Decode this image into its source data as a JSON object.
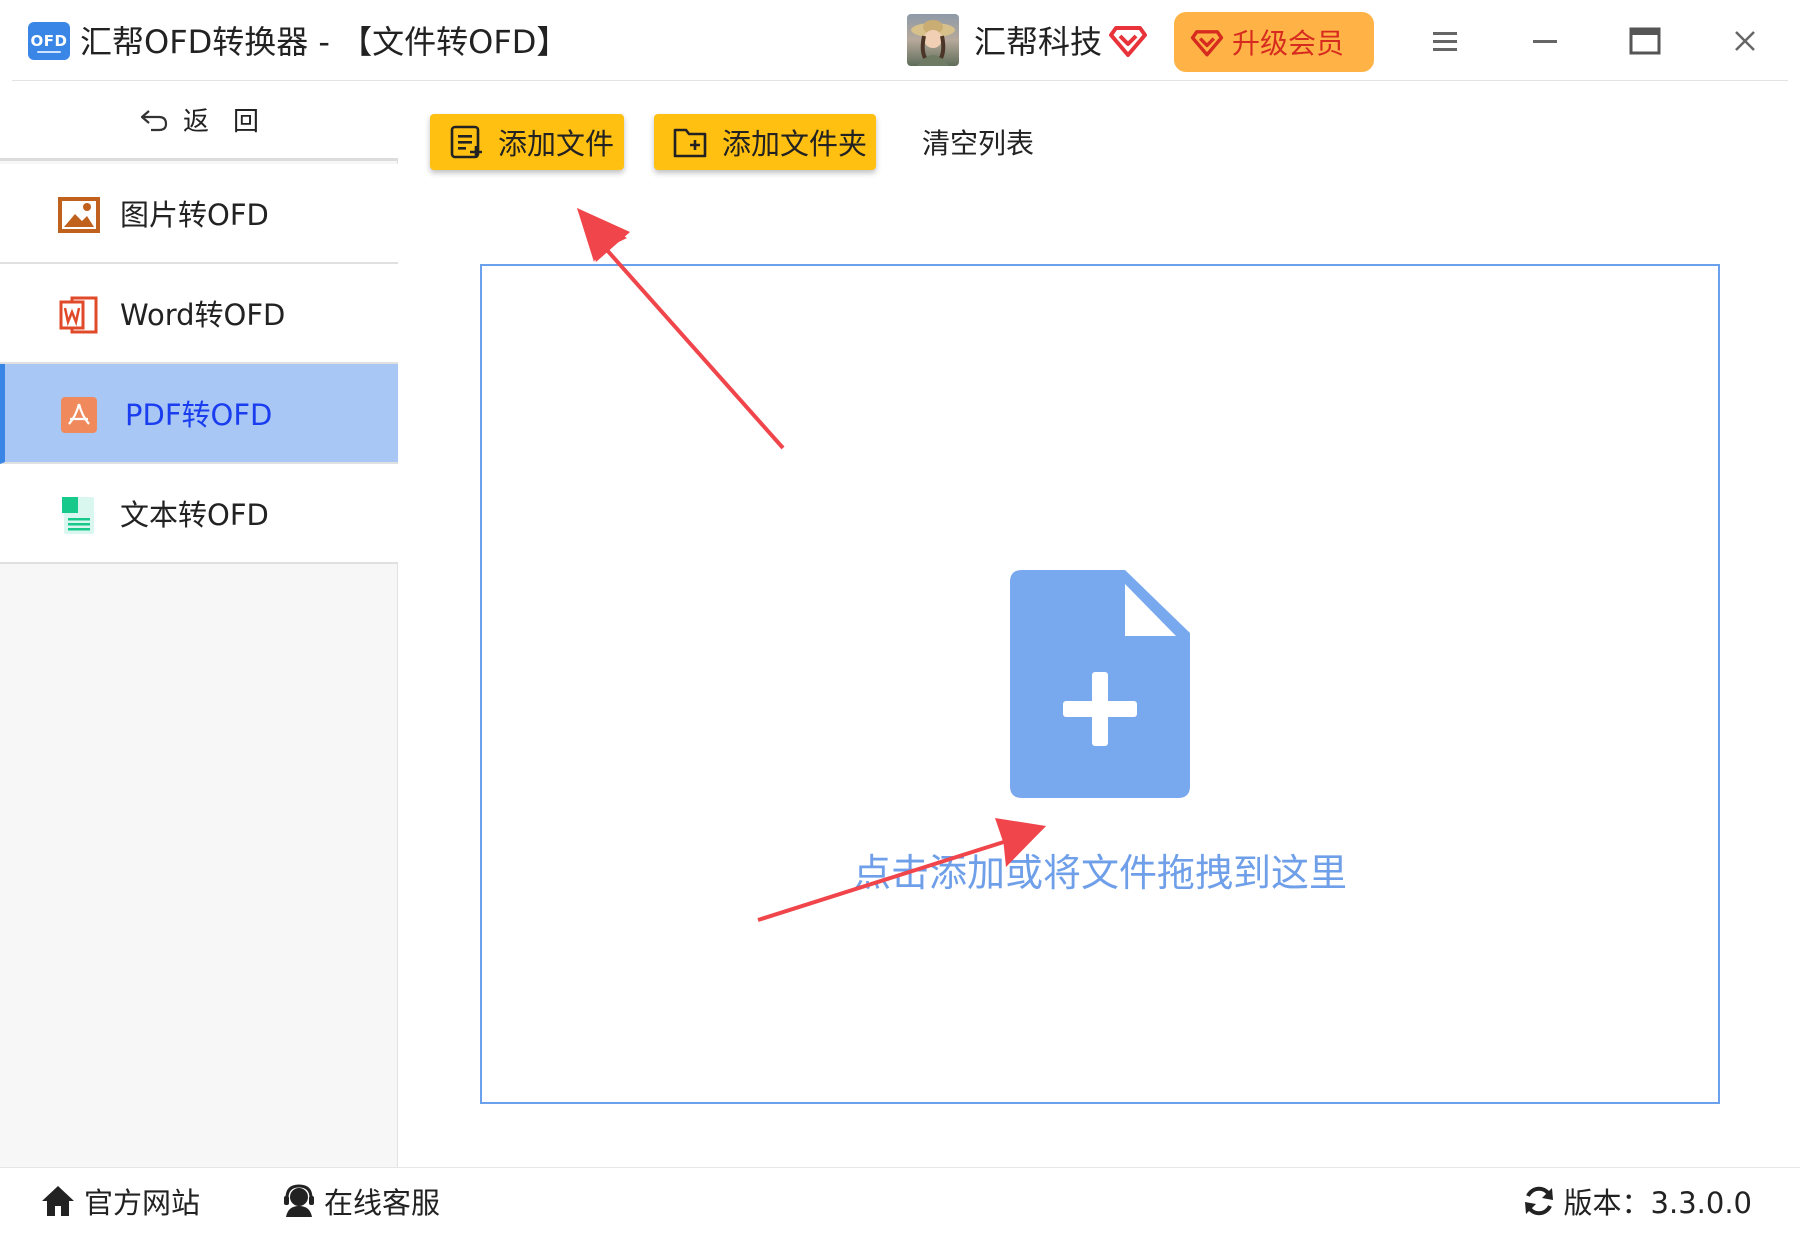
{
  "window": {
    "logo_text": "OFD",
    "title": "汇帮OFD转换器 - 【文件转OFD】",
    "user_name": "汇帮科技",
    "upgrade_label": "升级会员"
  },
  "sidebar": {
    "back_label": "返回",
    "items": [
      {
        "label": "图片转OFD",
        "icon": "image-icon"
      },
      {
        "label": "Word转OFD",
        "icon": "word-icon"
      },
      {
        "label": "PDF转OFD",
        "icon": "pdf-icon",
        "active": true
      },
      {
        "label": "文本转OFD",
        "icon": "text-file-icon"
      }
    ]
  },
  "toolbar": {
    "add_file_label": "添加文件",
    "add_folder_label": "添加文件夹",
    "clear_label": "清空列表"
  },
  "dropzone": {
    "hint": "点击添加或将文件拖拽到这里"
  },
  "footer": {
    "website_label": "官方网站",
    "support_label": "在线客服",
    "version_label": "版本：3.3.0.0"
  },
  "colors": {
    "accent_yellow": "#ffc012",
    "upgrade_orange": "#ffb347",
    "active_nav_bg": "#a9c7f5",
    "active_nav_text": "#1a3df0",
    "drop_icon_blue": "#78a9ee",
    "arrow_red": "#f0454a"
  }
}
